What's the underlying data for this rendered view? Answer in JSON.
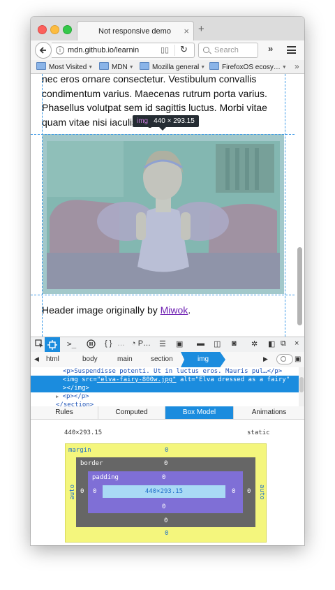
{
  "tab": {
    "title": "Not responsive demo",
    "close": "×",
    "new_tab": "+"
  },
  "nav": {
    "url": "mdn.github.io/learnin",
    "search_placeholder": "Search",
    "overflow": "»"
  },
  "bookmarks": {
    "items": [
      {
        "label": "Most Visited"
      },
      {
        "label": "MDN"
      },
      {
        "label": "Mozilla general"
      },
      {
        "label": "FirefoxOS ecosy…"
      }
    ],
    "more": "»"
  },
  "page": {
    "paragraph": "nec eros ornare consectetur. Vestibulum convallis condimentum varius. Maecenas rutrum porta varius. Phasellus volutpat sem id sagittis luctus. Morbi vitae quam vitae nisi iaculis dignissi",
    "caption_prefix": "Header image originally by ",
    "caption_link": "Miwok",
    "caption_suffix": ".",
    "infobar_tag": "img",
    "infobar_dims": "440 × 293.15"
  },
  "devtools": {
    "toolbar": {
      "icons": [
        "pick-icon",
        "inspector-icon",
        "console-icon",
        "debugger-icon",
        "style-editor-icon",
        "performance-icon",
        "network-icon",
        "responsive-icon",
        "screenshot-icon",
        "settings-icon",
        "dock-icon",
        "close-icon"
      ],
      "perf_label": "P…"
    },
    "breadcrumbs": [
      "html",
      "body",
      "main",
      "section",
      "img"
    ],
    "markup": {
      "line1": "<p>Suspendisse potenti. Ut in luctus eros. Mauris pul…</p>",
      "line2_tag": "<img src=",
      "line2_src": "\"elva-fairy-800w.jpg\"",
      "line2_attr": " alt=",
      "line2_alt": "\"Elva dressed as a fairy\"",
      "line3": "></img>",
      "line4": "<p></p>",
      "line5": "</section>"
    },
    "sidebar_tabs": [
      "Rules",
      "Computed",
      "Box Model",
      "Animations"
    ],
    "box_model": {
      "dimensions": "440×293.15",
      "position": "static",
      "margin_label": "margin",
      "border_label": "border",
      "padding_label": "padding",
      "content": "440×293.15",
      "margin": {
        "top": "0",
        "right": "auto",
        "bottom": "0",
        "left": "auto"
      },
      "border": {
        "top": "0",
        "right": "0",
        "bottom": "0",
        "left": "0"
      },
      "padding": {
        "top": "0",
        "right": "0",
        "bottom": "0",
        "left": "0"
      }
    }
  }
}
